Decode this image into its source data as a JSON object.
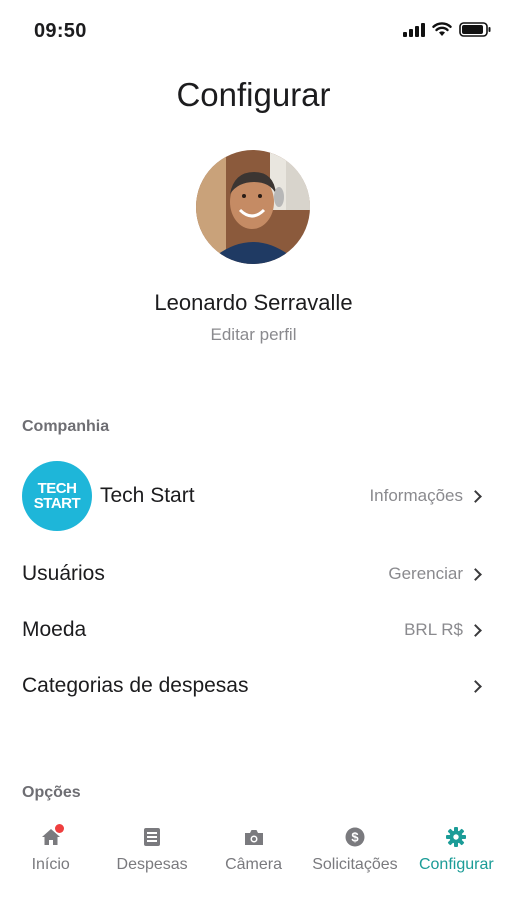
{
  "status_bar": {
    "time": "09:50"
  },
  "header": {
    "title": "Configurar"
  },
  "profile": {
    "name": "Leonardo Serravalle",
    "edit_label": "Editar perfil"
  },
  "company_section": {
    "title": "Companhia",
    "company": {
      "logo_line1": "TECH",
      "logo_line2": "START",
      "name": "Tech Start",
      "action": "Informações"
    },
    "rows": [
      {
        "label": "Usuários",
        "value": "Gerenciar"
      },
      {
        "label": "Moeda",
        "value": "BRL R$"
      },
      {
        "label": "Categorias de despesas",
        "value": ""
      }
    ]
  },
  "options_section": {
    "title": "Opções"
  },
  "tabbar": {
    "tabs": [
      {
        "label": "Início",
        "icon": "home-icon"
      },
      {
        "label": "Despesas",
        "icon": "receipt-icon"
      },
      {
        "label": "Câmera",
        "icon": "camera-icon"
      },
      {
        "label": "Solicitações",
        "icon": "dollar-icon"
      },
      {
        "label": "Configurar",
        "icon": "gear-icon"
      }
    ],
    "active_index": 4
  },
  "colors": {
    "accent": "#1b9c97",
    "company_logo": "#1eb6d9",
    "notification": "#ef3e3e"
  }
}
